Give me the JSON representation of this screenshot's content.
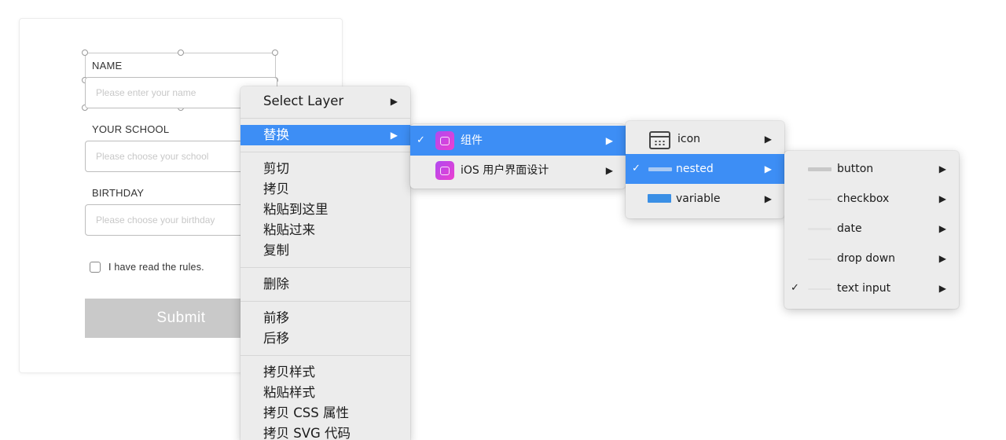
{
  "form": {
    "name_label": "NAME",
    "name_placeholder": "Please enter your name",
    "school_label": "YOUR SCHOOL",
    "school_placeholder": "Please choose your school",
    "birthday_label": "BIRTHDAY",
    "birthday_placeholder": "Please choose your birthday",
    "rules_text": "I have read the rules.",
    "submit_label": "Submit"
  },
  "context_menu": {
    "select_layer": "Select Layer",
    "replace": "替换",
    "cut": "剪切",
    "copy": "拷贝",
    "paste_here": "粘贴到这里",
    "paste_over": "粘贴过来",
    "duplicate": "复制",
    "delete": "删除",
    "bring_forward": "前移",
    "send_backward": "后移",
    "copy_style": "拷贝样式",
    "paste_style": "粘贴样式",
    "copy_css": "拷贝 CSS 属性",
    "copy_svg": "拷贝 SVG 代码"
  },
  "library_menu": {
    "components": "组件",
    "ios_design": "iOS 用户界面设计"
  },
  "category_menu": {
    "icon": "icon",
    "nested": "nested",
    "variable": "variable"
  },
  "nested_menu": {
    "items": [
      "button",
      "checkbox",
      "date",
      "drop down",
      "text input"
    ]
  },
  "glyphs": {
    "arrow": "▶",
    "check": "✓"
  },
  "colors": {
    "highlight": "#3d8ef5",
    "menu_bg": "#ececec",
    "submit_bg": "#c9c9c9",
    "swatch_blue": "#3a8fe5",
    "app_icon": "#c545e6"
  }
}
